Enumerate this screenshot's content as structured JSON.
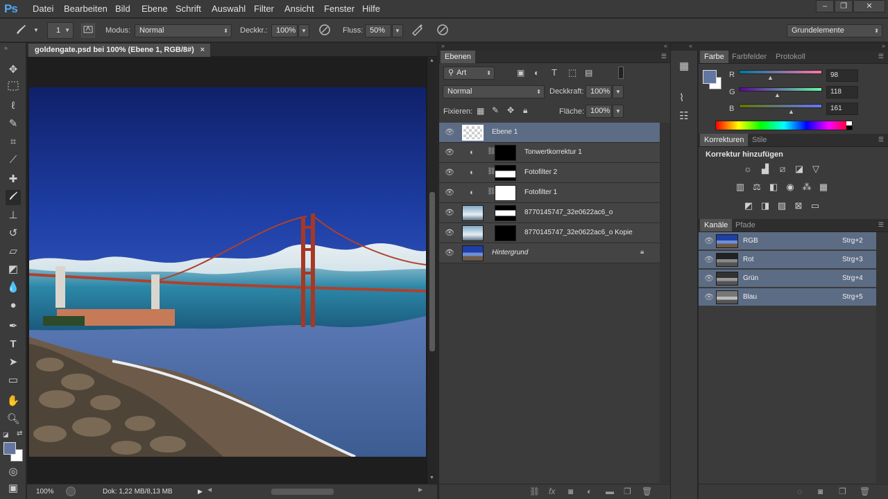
{
  "app": {
    "logo": "Ps"
  },
  "menu": [
    "Datei",
    "Bearbeiten",
    "Bild",
    "Ebene",
    "Schrift",
    "Auswahl",
    "Filter",
    "Ansicht",
    "Fenster",
    "Hilfe"
  ],
  "window_buttons": [
    "‒",
    "❐",
    "✕"
  ],
  "options": {
    "brush_size": "1",
    "modus_label": "Modus:",
    "modus_value": "Normal",
    "deckkr_label": "Deckkr.:",
    "deckkr_value": "100%",
    "fluss_label": "Fluss:",
    "fluss_value": "50%",
    "workspace": "Grundelemente"
  },
  "document": {
    "tab_title": "goldengate.psd bei 100% (Ebene 1, RGB/8#)",
    "close": "×",
    "zoom": "100%",
    "doc_size": "Dok: 1,22 MB/8,13 MB"
  },
  "layers_panel": {
    "tab": "Ebenen",
    "filter_kind": "Art",
    "blend_mode": "Normal",
    "opacity_label": "Deckkraft:",
    "opacity_value": "100%",
    "lock_label": "Fixieren:",
    "fill_label": "Fläche:",
    "fill_value": "100%",
    "layers": [
      {
        "name": "Ebene 1",
        "selected": true
      },
      {
        "name": "Tonwertkorrektur 1",
        "selected": false
      },
      {
        "name": "Fotofilter 2",
        "selected": false
      },
      {
        "name": "Fotofilter 1",
        "selected": false
      },
      {
        "name": "8770145747_32e0622ac6_o",
        "selected": false
      },
      {
        "name": "8770145747_32e0622ac6_o  Kopie",
        "selected": false
      },
      {
        "name": "Hintergrund",
        "selected": false
      }
    ]
  },
  "color_panel": {
    "tabs": [
      "Farbe",
      "Farbfelder",
      "Protokoll"
    ],
    "r_label": "R",
    "r_value": "98",
    "g_label": "G",
    "g_value": "118",
    "b_label": "B",
    "b_value": "161",
    "fg_color": "#6276a1"
  },
  "adjustments_panel": {
    "tabs": [
      "Korrekturen",
      "Stile"
    ],
    "heading": "Korrektur hinzufügen"
  },
  "channels_panel": {
    "tabs": [
      "Kanäle",
      "Pfade"
    ],
    "channels": [
      {
        "name": "RGB",
        "shortcut": "Strg+2"
      },
      {
        "name": "Rot",
        "shortcut": "Strg+3"
      },
      {
        "name": "Grün",
        "shortcut": "Strg+4"
      },
      {
        "name": "Blau",
        "shortcut": "Strg+5"
      }
    ]
  }
}
